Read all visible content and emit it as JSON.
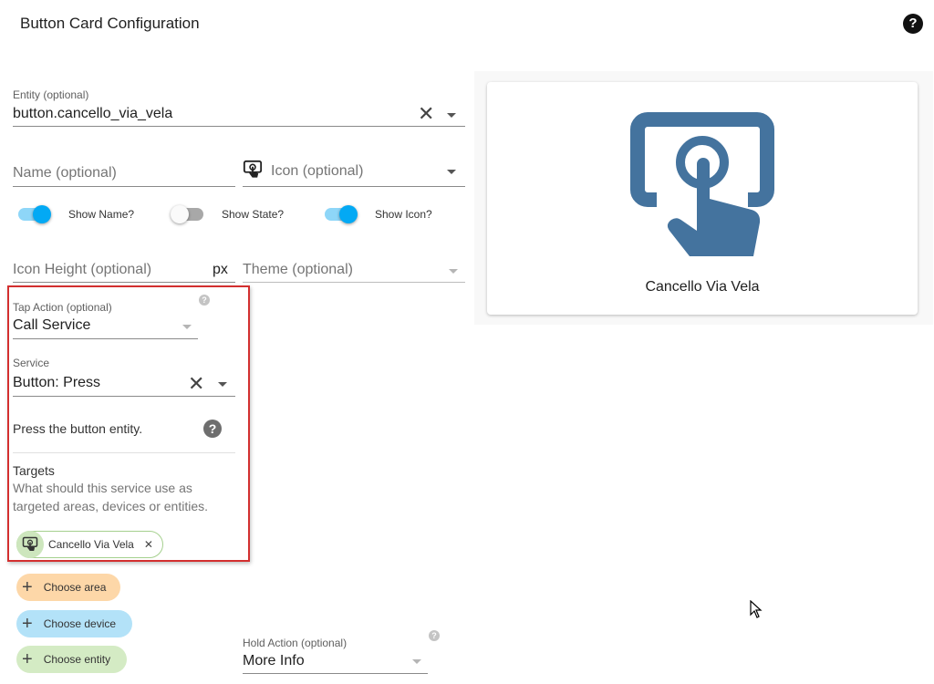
{
  "header": {
    "title": "Button Card Configuration"
  },
  "entity": {
    "label": "Entity (optional)",
    "value": "button.cancello_via_vela"
  },
  "name": {
    "placeholder": "Name (optional)"
  },
  "icon": {
    "placeholder": "Icon (optional)"
  },
  "toggles": {
    "show_name": {
      "label": "Show Name?",
      "on": true
    },
    "show_state": {
      "label": "Show State?",
      "on": false
    },
    "show_icon": {
      "label": "Show Icon?",
      "on": true
    }
  },
  "icon_height": {
    "placeholder": "Icon Height (optional)",
    "suffix": "px"
  },
  "theme": {
    "placeholder": "Theme (optional)"
  },
  "tap_action": {
    "label": "Tap Action (optional)",
    "value": "Call Service",
    "service": {
      "label": "Service",
      "value": "Button: Press"
    },
    "description": "Press the button entity.",
    "targets": {
      "title": "Targets",
      "description_line1": "What should this service use as",
      "description_line2": "targeted areas, devices or entities.",
      "chip": "Cancello Via Vela"
    }
  },
  "choose": {
    "area": "Choose area",
    "device": "Choose device",
    "entity": "Choose entity"
  },
  "hold_action": {
    "label": "Hold Action (optional)",
    "value": "More Info"
  },
  "preview": {
    "name": "Cancello Via Vela"
  },
  "colors": {
    "accent": "#03a9f4",
    "icon": "#44739e",
    "chip_area": "#fdd7a8",
    "chip_device": "#b3e2f8",
    "chip_entity": "#d4ebc4",
    "highlight_box": "#d32f2f"
  }
}
